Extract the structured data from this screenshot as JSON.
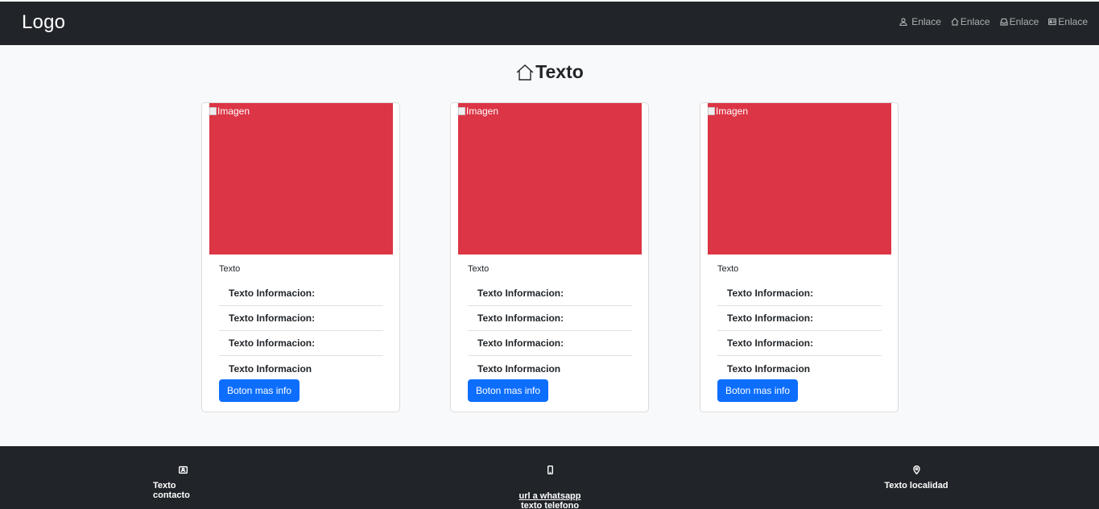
{
  "navbar": {
    "logo": "Logo",
    "links": [
      {
        "label": "Enlace",
        "icon": "person-icon"
      },
      {
        "label": "Enlace",
        "icon": "home-icon"
      },
      {
        "label": "Enlace",
        "icon": "inbox-icon"
      },
      {
        "label": "Enlace",
        "icon": "contact-card-icon"
      }
    ]
  },
  "main": {
    "title": "Texto",
    "cards": [
      {
        "image_alt": "Imagen",
        "text": "Texto",
        "info": [
          "Texto Informacion:",
          "Texto Informacion:",
          "Texto Informacion:",
          "Texto Informacion"
        ],
        "button": "Boton mas info"
      },
      {
        "image_alt": "Imagen",
        "text": "Texto",
        "info": [
          "Texto Informacion:",
          "Texto Informacion:",
          "Texto Informacion:",
          "Texto Informacion"
        ],
        "button": "Boton mas info"
      },
      {
        "image_alt": "Imagen",
        "text": "Texto",
        "info": [
          "Texto Informacion:",
          "Texto Informacion:",
          "Texto Informacion:",
          "Texto Informacion"
        ],
        "button": "Boton mas info"
      }
    ]
  },
  "footer": {
    "contact": {
      "icon": "contact-card-icon",
      "label": "Texto contacto"
    },
    "phone": {
      "icon": "phone-icon",
      "whatsapp_link": "url a whatsapp",
      "phone_text": "texto telefono"
    },
    "location": {
      "icon": "location-pin-icon",
      "label": "Texto localidad"
    }
  },
  "colors": {
    "navbar_bg": "#212529",
    "image_placeholder": "#dc3545",
    "button": "#0d6efd",
    "page_bg": "#f8f9fa"
  }
}
